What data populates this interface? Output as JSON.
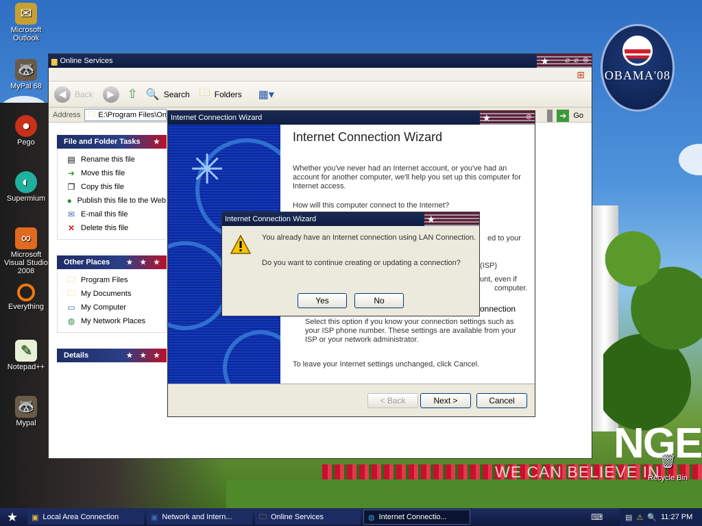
{
  "desktop": {
    "icons": [
      {
        "label": "Microsoft Outlook"
      },
      {
        "label": "MyPal 68"
      },
      {
        "label": "Pego"
      },
      {
        "label": "Supermium"
      },
      {
        "label": "Microsoft Visual Studio 2008"
      },
      {
        "label": "Everything"
      },
      {
        "label": "Notepad++"
      },
      {
        "label": "Mypal"
      }
    ],
    "recycle_bin": "Recycle Bin",
    "wallpaper_badge": "OBAMA'08",
    "wallpaper_headline": "NGE",
    "wallpaper_tagline": "WE CAN BELIEVE IN"
  },
  "explorer": {
    "title": "Online Services",
    "toolbar": {
      "back": "Back",
      "search": "Search",
      "folders": "Folders"
    },
    "address_label": "Address",
    "address_value": "E:\\Program Files\\Online",
    "go_label": "Go",
    "file_tasks": {
      "heading": "File and Folder Tasks",
      "items": [
        "Rename this file",
        "Move this file",
        "Copy this file",
        "Publish this file to the Web",
        "E-mail this file",
        "Delete this file"
      ]
    },
    "other_places": {
      "heading": "Other Places",
      "items": [
        "Program Files",
        "My Documents",
        "My Computer",
        "My Network Places"
      ]
    },
    "details": {
      "heading": "Details"
    }
  },
  "wizard": {
    "title": "Internet Connection Wizard",
    "heading": "Internet Connection Wizard",
    "intro": "Whether you've never had an Internet account, or you've had an account for another computer, we'll help you set up this computer for Internet access.",
    "question": "How will this computer connect to the Internet?",
    "frag_connected": "ed to your",
    "frag_isp": "(ISP)",
    "frag_even": "unt, even if",
    "frag_computer": "computer.",
    "frag_connection": "onnection",
    "manual_desc": "Select this option if you know your connection settings such as your ISP phone number.  These settings are available from your ISP or your network administrator.",
    "leave_text": "To leave your Internet settings unchanged, click Cancel.",
    "back_button": "< Back",
    "next_button": "Next >",
    "cancel_button": "Cancel"
  },
  "dialog": {
    "title": "Internet Connection Wizard",
    "message": "You already have an Internet connection using LAN Connection.",
    "question": "Do you want to continue creating or updating a connection?",
    "yes_button": "Yes",
    "no_button": "No"
  },
  "taskbar": {
    "tasks": [
      {
        "label": "Local Area Connection"
      },
      {
        "label": "Network and Intern..."
      },
      {
        "label": "Online Services"
      },
      {
        "label": "Internet Connectio..."
      }
    ],
    "clock": "11:27 PM"
  },
  "colors": {
    "titlebar": "#0f1d40",
    "accent_red": "#b8132a",
    "wizard_side": "#1438b8"
  }
}
